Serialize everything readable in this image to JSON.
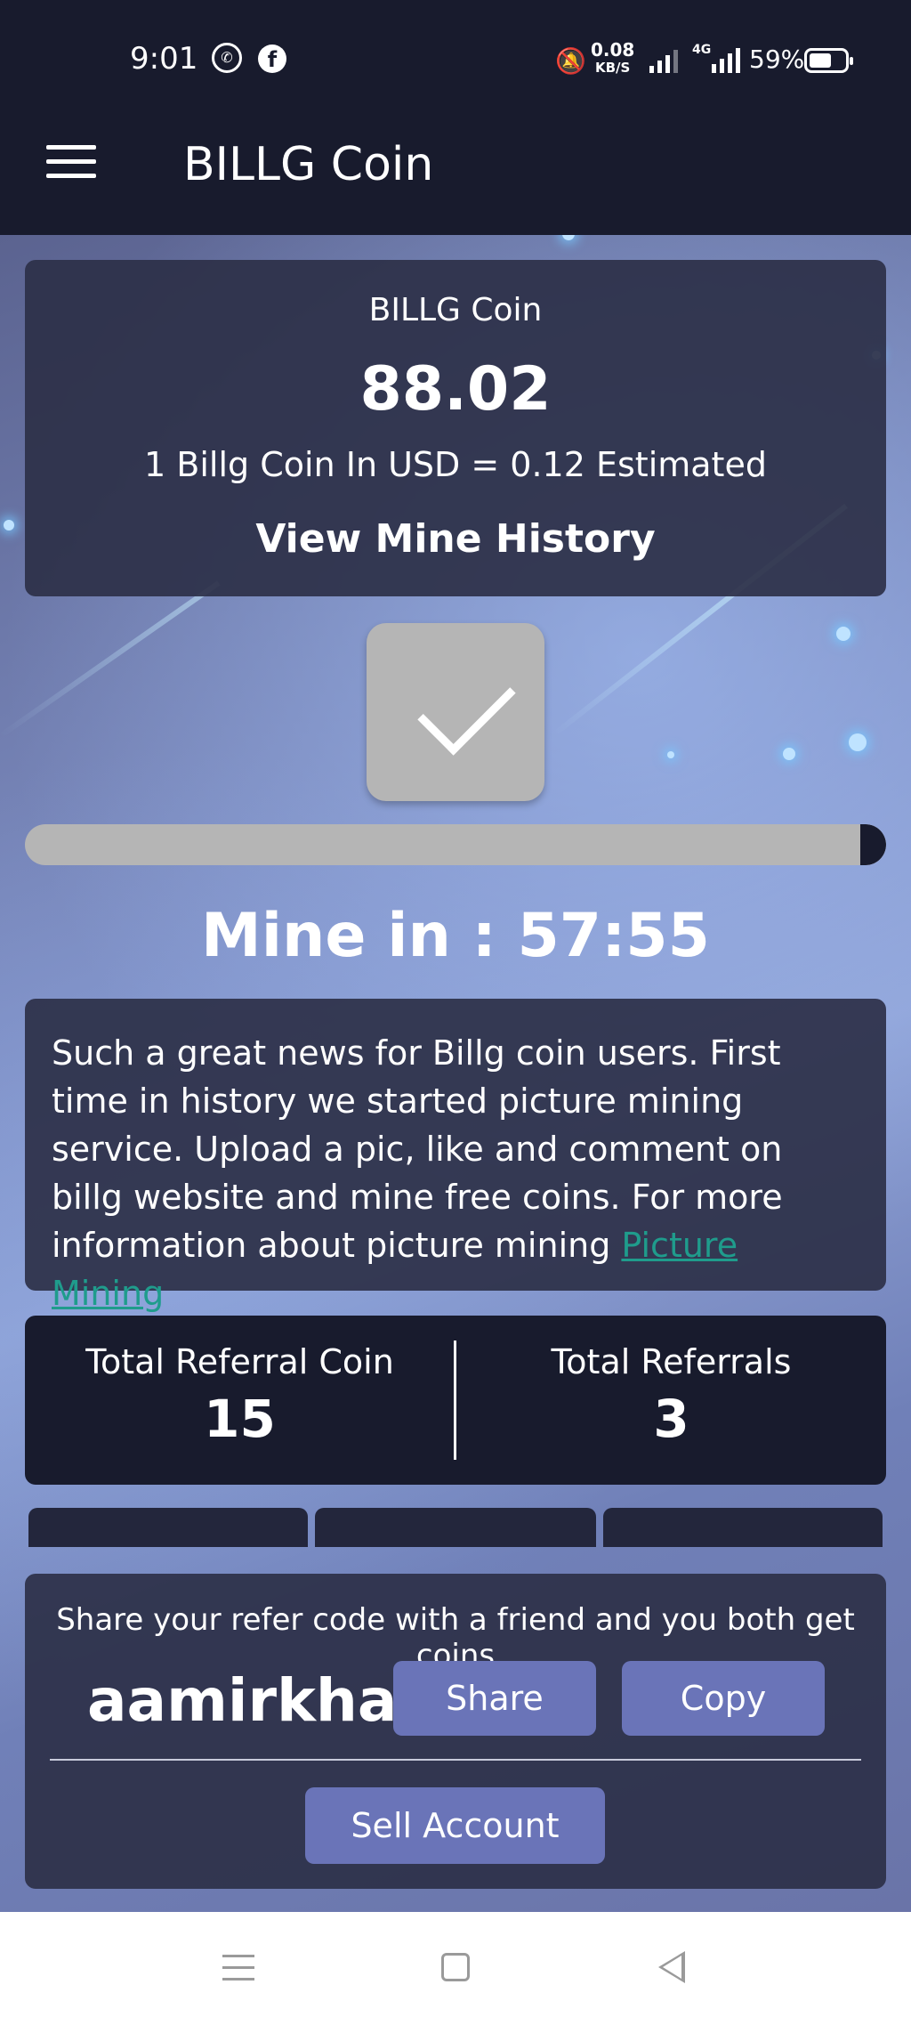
{
  "status_bar": {
    "time": "9:01",
    "net_speed_value": "0.08",
    "net_speed_unit": "KB/S",
    "network_type": "4G",
    "battery": "59%"
  },
  "app_bar": {
    "title": "BILLG Coin"
  },
  "balance": {
    "label": "BILLG Coin",
    "value": "88.02",
    "rate": "1 Billg Coin In USD = 0.12 Estimated",
    "history_link": "View Mine History"
  },
  "mining": {
    "progress_fraction": 0.03,
    "timer_text": "Mine in : 57:55"
  },
  "news": {
    "text": "Such a great news for Billg coin users. First time in history we started picture mining service. Upload a pic, like and comment on billg website and mine free coins. For more information about picture mining ",
    "link_text": "Picture Mining"
  },
  "referrals": {
    "coin_label": "Total Referral Coin",
    "coin_value": "15",
    "count_label": "Total Referrals",
    "count_value": "3"
  },
  "share": {
    "text": "Share your refer code with a friend and you both get coins",
    "code": "aamirkhan",
    "share_label": "Share",
    "copy_label": "Copy",
    "sell_label": "Sell Account"
  },
  "colors": {
    "header_bg": "#181b2d",
    "button_accent": "#6a74b8",
    "link": "#1f9c8c"
  }
}
